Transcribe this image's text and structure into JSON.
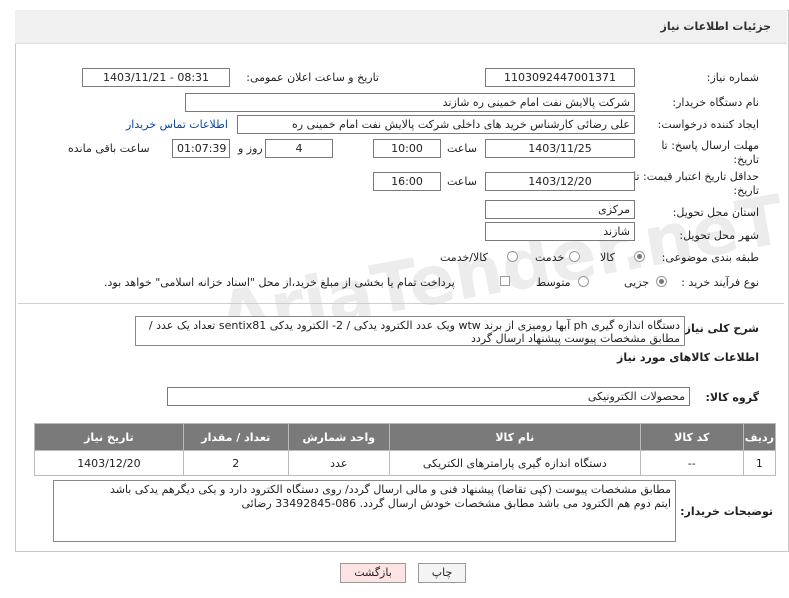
{
  "header": {
    "title": "جزئیات اطلاعات نیاز"
  },
  "fields": {
    "need_number_label": "شماره نیاز:",
    "need_number": "1103092447001371",
    "announce_label": "تاریخ و ساعت اعلان عمومی:",
    "announce_value": "1403/11/21 - 08:31",
    "buyer_org_label": "نام دستگاه خریدار:",
    "buyer_org": "شرکت پالایش نفت امام خمینی  ره  شازند",
    "creator_label": "ایجاد کننده درخواست:",
    "creator": "علی  رضائی کارشناس خرید های داخلی  شرکت پالایش نفت امام خمینی  ره",
    "contact_link": "اطلاعات تماس خریدار",
    "deadline_label": "مهلت ارسال پاسخ: تا تاریخ:",
    "deadline_date": "1403/11/25",
    "deadline_time_label": "ساعت",
    "deadline_time": "10:00",
    "days_value": "4",
    "days_label": "روز و",
    "remaining_time": "01:07:39",
    "remaining_label": "ساعت باقی مانده",
    "validity_label": "حداقل تاریخ اعتبار قیمت: تا تاریخ:",
    "validity_date": "1403/12/20",
    "validity_time_label": "ساعت",
    "validity_time": "16:00",
    "province_label": "استان محل تحویل:",
    "province": "مرکزی",
    "city_label": "شهر محل تحویل:",
    "city": "شازند",
    "category_label": "طبقه بندی موضوعی:",
    "category_options": [
      "کالا",
      "خدمت",
      "کالا/خدمت"
    ],
    "process_label": "نوع فرآیند خرید :",
    "process_options": [
      "جزیی",
      "متوسط"
    ],
    "payment_note": "پرداخت تمام یا بخشی از مبلغ خرید،از محل \"اسناد خزانه اسلامی\" خواهد بود."
  },
  "general_desc": {
    "label": "شرح کلی نیاز:",
    "text": "دستگاه اندازه گیری ph آبها رومیزی از برند wtw  ویک عدد الکترود یدکی / 2- الکترود یدکی sentix81  تعداد یک عدد / مطابق مشخصات پیوست پیشنهاد ارسال گردد"
  },
  "goods_section_title": "اطلاعات کالاهای مورد نیاز",
  "goods_group": {
    "label": "گروه کالا:",
    "value": "محصولات الکترونیکی"
  },
  "table": {
    "headers": [
      "ردیف",
      "کد کالا",
      "نام کالا",
      "واحد شمارش",
      "تعداد / مقدار",
      "تاریخ نیاز"
    ],
    "rows": [
      [
        "1",
        "--",
        "دستگاه اندازه گیری پارامترهای الکتریکی",
        "عدد",
        "2",
        "1403/12/20"
      ]
    ]
  },
  "buyer_notes": {
    "label": "توضیحات خریدار:",
    "line1": "مطابق مشخصات پیوست (کپی تقاضا) پیشنهاد فنی و مالی ارسال گردد/    روی دستگاه الکترود دارد و یکی دیگرهم یدکی باشد",
    "line2": "ایتم دوم هم الکترود می باشد  مطابق مشخصات خودش ارسال گردد. 086-33492845  رضائی"
  },
  "buttons": {
    "print": "چاپ",
    "back": "بازگشت"
  },
  "watermark": {
    "logo": "AriaTender.neT"
  },
  "colors": {
    "back_button_bg": "#fde3e3",
    "print_button_bg": "#f4f4f4",
    "table_header_bg": "#7a7a7a",
    "link": "#0645ad"
  }
}
